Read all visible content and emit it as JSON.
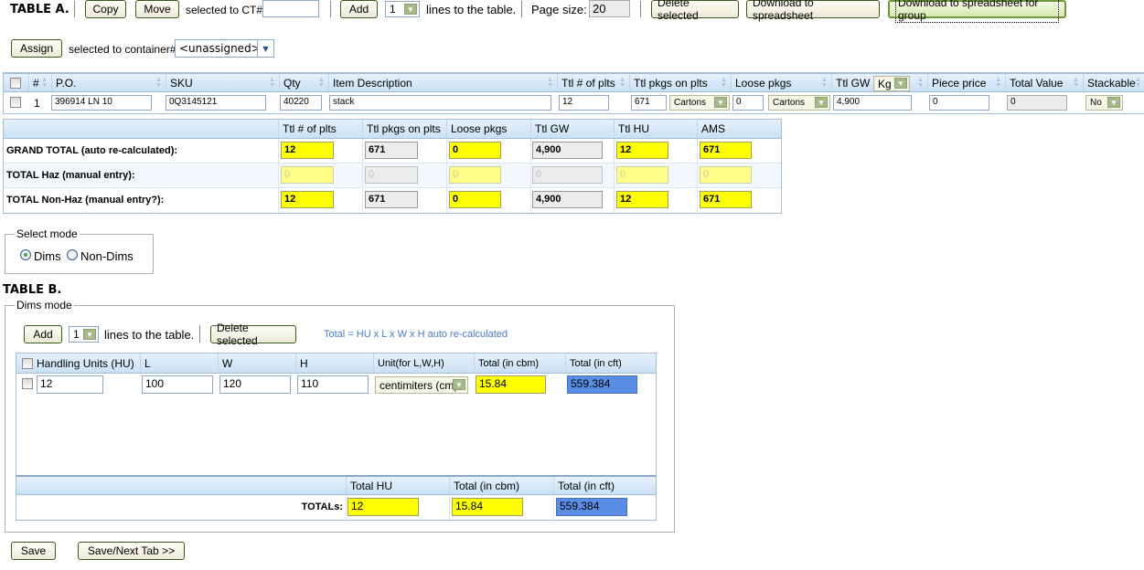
{
  "table_a": {
    "title": "TABLE A.",
    "toolbar": {
      "copy_label": "Copy",
      "move_label": "Move",
      "selected_to_ct_label": "selected to CT#:",
      "ct_value": "",
      "add_label": "Add",
      "lines_count": "1",
      "lines_label": "lines to the table.",
      "page_size_label": "Page size:",
      "page_size_value": "20",
      "delete_selected_label": "Delete selected",
      "download_label": "Download to spreadsheet",
      "download_group_label": "Download to spreadsheet for group"
    },
    "assign": {
      "assign_label": "Assign",
      "selected_to_container_label": "selected to container#:",
      "container_value": "<unassigned>"
    },
    "columns": [
      "#",
      "P.O.",
      "SKU",
      "Qty",
      "Item Description",
      "Ttl # of plts",
      "Ttl pkgs on plts",
      "Loose pkgs",
      "Ttl GW",
      "Piece price",
      "Total Value",
      "Stackable"
    ],
    "gw_unit": "Kg",
    "rows": [
      {
        "num": "1",
        "po": "396914 LN 10",
        "sku": "0Q3145121",
        "qty": "40220",
        "description": "stack",
        "plts": "12",
        "pkgs_on_plts": "671",
        "pkgs_unit": "Cartons",
        "loose_pkgs": "0",
        "loose_unit": "Cartons",
        "gw": "4,900",
        "piece_price": "0",
        "total_value": "0",
        "stackable": "No"
      }
    ],
    "totals": {
      "columns": [
        "Ttl # of plts",
        "Ttl pkgs on plts",
        "Loose pkgs",
        "Ttl GW",
        "Ttl HU",
        "AMS"
      ],
      "rows": [
        {
          "label": "GRAND TOTAL (auto re-calculated):",
          "values": [
            "12",
            "671",
            "0",
            "4,900",
            "12",
            "671"
          ]
        },
        {
          "label": "TOTAL Haz (manual entry):",
          "values": [
            "0",
            "0",
            "0",
            "0",
            "0",
            "0"
          ]
        },
        {
          "label": "TOTAL Non-Haz (manual entry?):",
          "values": [
            "12",
            "671",
            "0",
            "4,900",
            "12",
            "671"
          ]
        }
      ]
    }
  },
  "select_mode": {
    "legend": "Select mode",
    "options": [
      "Dims",
      "Non-Dims"
    ],
    "selected": "Dims"
  },
  "table_b": {
    "title": "TABLE B.",
    "legend": "Dims mode",
    "add_label": "Add",
    "lines_count": "1",
    "lines_label": "lines to the table.",
    "delete_selected_label": "Delete selected",
    "hint": "Total = HU x L x W x H auto re-calculated",
    "columns": [
      "Handling Units (HU)",
      "L",
      "W",
      "H",
      "Unit(for L,W,H)",
      "Total (in cbm)",
      "Total (in cft)"
    ],
    "rows": [
      {
        "hu": "12",
        "l": "100",
        "w": "120",
        "h": "110",
        "unit": "centimiters (cm)",
        "cbm": "15.84",
        "cft": "559.384"
      }
    ],
    "totals": {
      "columns": [
        "Total HU",
        "Total (in cbm)",
        "Total (in cft)"
      ],
      "label": "TOTALs:",
      "hu": "12",
      "cbm": "15.84",
      "cft": "559.384"
    }
  },
  "footer": {
    "save_label": "Save",
    "save_next_label": "Save/Next Tab >>"
  }
}
